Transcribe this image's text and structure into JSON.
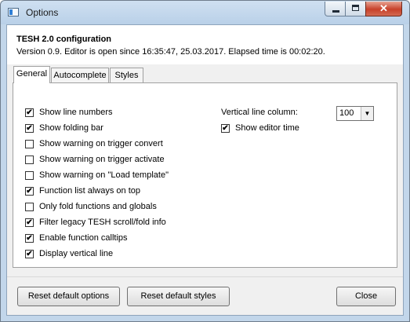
{
  "window": {
    "title": "Options"
  },
  "header": {
    "title": "TESH 2.0 configuration",
    "version_text": "Version 0.9. Editor is open since 16:35:47, 25.03.2017. Elapsed time is 00:02:20."
  },
  "tabs": [
    {
      "label": "General",
      "active": true
    },
    {
      "label": "Autocomplete",
      "active": false
    },
    {
      "label": "Styles",
      "active": false
    }
  ],
  "general": {
    "options": [
      {
        "label": "Show line numbers",
        "checked": true
      },
      {
        "label": "Show folding bar",
        "checked": true
      },
      {
        "label": "Show warning on trigger convert",
        "checked": false
      },
      {
        "label": "Show warning on trigger activate",
        "checked": false
      },
      {
        "label": "Show warning on \"Load template\"",
        "checked": false
      },
      {
        "label": "Function list always on top",
        "checked": true
      },
      {
        "label": "Only fold functions and globals",
        "checked": false
      },
      {
        "label": "Filter legacy TESH scroll/fold info",
        "checked": true
      },
      {
        "label": "Enable function calltips",
        "checked": true
      },
      {
        "label": "Display vertical line",
        "checked": true
      }
    ],
    "vertical_line_label": "Vertical line column:",
    "vertical_line_value": "100",
    "show_editor_time": {
      "label": "Show editor time",
      "checked": true
    }
  },
  "buttons": {
    "reset_options": "Reset default options",
    "reset_styles": "Reset default styles",
    "close": "Close"
  },
  "colors": {
    "title_bar": "#c2d6ea",
    "close_button": "#c7412a"
  }
}
